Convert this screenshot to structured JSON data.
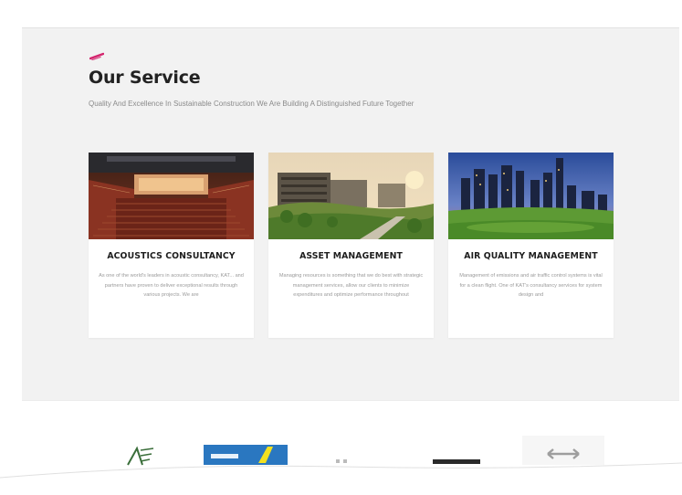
{
  "section": {
    "title": "Our Service",
    "subtitle": "Quality And Excellence In Sustainable Construction We Are Building A Distinguished Future Together"
  },
  "services": [
    {
      "title": "ACOUSTICS CONSULTANCY",
      "description": "As one of the world's leaders in acoustic consultancy, KAT... and partners have proven to deliver exceptional results through various projects. We are",
      "image": "concert-hall-image"
    },
    {
      "title": "ASSET MANAGEMENT",
      "description": "Managing resources is something that we do best with strategic management services, allow our clients to minimize expenditures and optimize performance throughout",
      "image": "green-buildings-image"
    },
    {
      "title": "AIR QUALITY MANAGEMENT",
      "description": "Management of emissions and air traffic control systems is vital for a clean flight. One of KAT's consultancy services for system design and",
      "image": "city-skyline-image"
    }
  ],
  "partners": [
    {
      "name": "",
      "icon": "leaf-logo"
    },
    {
      "name": "",
      "icon": "blue-banner-logo"
    },
    {
      "name": "",
      "icon": "dark-bar-logo"
    },
    {
      "name": "",
      "icon": "arrows-logo"
    }
  ],
  "colors": {
    "accent": "#d4256e",
    "section_bg": "#f2f2f2",
    "card_bg": "#ffffff",
    "title_text": "#222222",
    "muted_text": "#9a9a9a"
  }
}
